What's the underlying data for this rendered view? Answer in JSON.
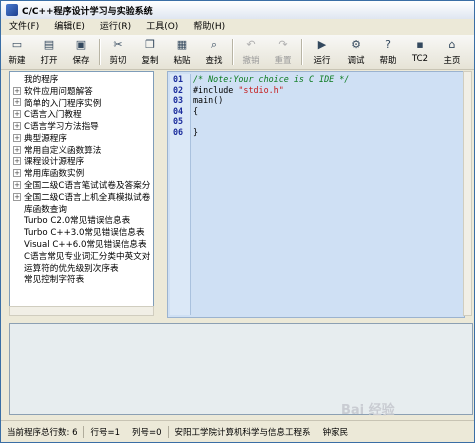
{
  "window": {
    "title": "C/C++程序设计学习与实验系统"
  },
  "menu": [
    "文件(F)",
    "编辑(E)",
    "运行(R)",
    "工具(O)",
    "帮助(H)"
  ],
  "toolbar": [
    {
      "label": "新建",
      "icon": "new-file-icon",
      "disabled": false
    },
    {
      "label": "打开",
      "icon": "open-folder-icon",
      "disabled": false
    },
    {
      "label": "保存",
      "icon": "save-icon",
      "disabled": false
    },
    {
      "label": "剪切",
      "icon": "cut-icon",
      "disabled": false
    },
    {
      "label": "复制",
      "icon": "copy-icon",
      "disabled": false
    },
    {
      "label": "粘贴",
      "icon": "paste-icon",
      "disabled": false
    },
    {
      "label": "查找",
      "icon": "find-icon",
      "disabled": false
    },
    {
      "label": "撤销",
      "icon": "undo-icon",
      "disabled": true
    },
    {
      "label": "重置",
      "icon": "redo-icon",
      "disabled": true
    },
    {
      "label": "运行",
      "icon": "run-icon",
      "disabled": false
    },
    {
      "label": "调试",
      "icon": "debug-icon",
      "disabled": false
    },
    {
      "label": "帮助",
      "icon": "help-icon",
      "disabled": false
    },
    {
      "label": "TC2",
      "icon": "tc2-icon",
      "disabled": false
    },
    {
      "label": "主页",
      "icon": "home-icon",
      "disabled": false
    }
  ],
  "tree": [
    {
      "label": "我的程序",
      "expandable": false
    },
    {
      "label": "软件应用问题解答",
      "expandable": true
    },
    {
      "label": "简单的入门程序实例",
      "expandable": true
    },
    {
      "label": "C语言入门教程",
      "expandable": true
    },
    {
      "label": "C语言学习方法指导",
      "expandable": true
    },
    {
      "label": "典型源程序",
      "expandable": true
    },
    {
      "label": "常用自定义函数算法",
      "expandable": true
    },
    {
      "label": "课程设计源程序",
      "expandable": true
    },
    {
      "label": "常用库函数实例",
      "expandable": true
    },
    {
      "label": "全国二级C语言笔试试卷及答案分",
      "expandable": true
    },
    {
      "label": "全国二级C语言上机全真模拟试卷",
      "expandable": true
    },
    {
      "label": "库函数查询",
      "expandable": false
    },
    {
      "label": "Turbo C2.0常见错误信息表",
      "expandable": false
    },
    {
      "label": "Turbo C++3.0常见错误信息表",
      "expandable": false
    },
    {
      "label": "Visual C++6.0常见错误信息表",
      "expandable": false
    },
    {
      "label": "C语言常见专业词汇分类中英文对",
      "expandable": false
    },
    {
      "label": "运算符的优先级别次序表",
      "expandable": false
    },
    {
      "label": "常见控制字符表",
      "expandable": false
    }
  ],
  "editor": {
    "line_numbers": [
      "01",
      "02",
      "03",
      "04",
      "05",
      "06"
    ],
    "lines": [
      [
        {
          "t": "/* Note:Your choice is C IDE */",
          "c": "comment"
        }
      ],
      [
        {
          "t": "#include ",
          "c": "kw"
        },
        {
          "t": "\"stdio.h\"",
          "c": "str"
        }
      ],
      [
        {
          "t": "main()",
          "c": "kw"
        }
      ],
      [
        {
          "t": "{",
          "c": "kw"
        }
      ],
      [
        {
          "t": "",
          "c": "kw"
        }
      ],
      [
        {
          "t": "}",
          "c": "kw"
        }
      ]
    ]
  },
  "status": {
    "total_lines": "当前程序总行数:   6",
    "row": "行号=1",
    "col": "列号=0",
    "org": "安阳工学院计算机科学与信息工程系",
    "author": "钟家民"
  },
  "watermark": "Bai 经验"
}
